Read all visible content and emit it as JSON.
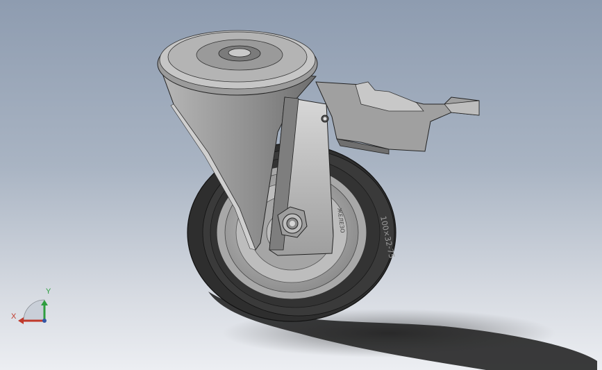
{
  "viewport": {
    "background_top": "#8e9cb0",
    "background_bottom": "#eceef2"
  },
  "model": {
    "tire_marking": "100×32-75",
    "rim_marking": "ЖЕЛЕЗО"
  },
  "triad": {
    "x_label": "X",
    "y_label": "Y",
    "x_color": "#c0392b",
    "y_color": "#2e9e3f"
  }
}
